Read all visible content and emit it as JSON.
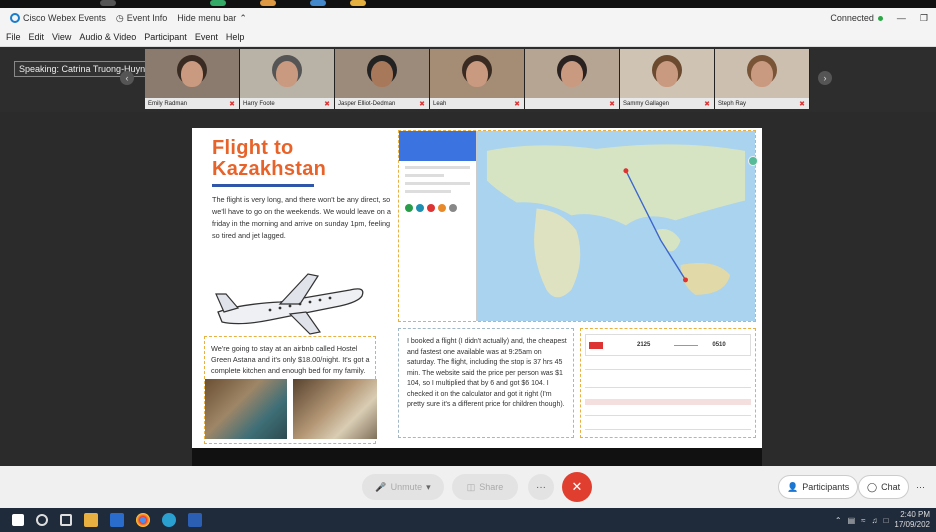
{
  "window": {
    "app_title": "Cisco Webex Events",
    "event_info": "Event Info",
    "hide_menu": "Hide menu bar",
    "status": "Connected"
  },
  "menu": [
    "File",
    "Edit",
    "View",
    "Audio & Video",
    "Participant",
    "Event",
    "Help"
  ],
  "speaking": "Speaking: Catrina Truong-Huynh",
  "participants": [
    {
      "name": "Emily Radman"
    },
    {
      "name": "Harry Foote"
    },
    {
      "name": "Jasper Elliot-Dedman"
    },
    {
      "name": "Leah"
    },
    {
      "name": ""
    },
    {
      "name": "Sammy Gallagen"
    },
    {
      "name": "Steph Ray"
    }
  ],
  "slide": {
    "title_line1": "Flight to",
    "title_line2": "Kazakhstan",
    "intro": "The flight is very long, and there won't be any direct, so we'll have to go on the weekends. We would leave on a friday in the morning and arrive on sunday 1pm, feeling so tired and jet lagged.",
    "hostel": "We're going to stay at an airbnb called Hostel Green Astana and it's only $18.00/night. It's got a complete kitchen and enough bed for my family.",
    "flight": "I booked a flight (I didn't actually) and, the cheapest and fastest one available was at 9:25am on saturday. The flight, including the stop is 37 hrs 45 min. The website said the price per person was $1 104, so I multiplied that by 6 and got $6 104. I checked it on the calculator and got it right (I'm pretty sure it's a different price for children though)."
  },
  "itinerary": {
    "depart": "2125",
    "arrive": "0510"
  },
  "controls": {
    "unmute": "Unmute",
    "share": "Share",
    "more": "···",
    "end": "✕",
    "participants": "Participants",
    "chat": "Chat",
    "menu": "···"
  },
  "taskbar": {
    "time": "2:40 PM",
    "date": "17/09/202"
  },
  "colors": {
    "accent_orange": "#e8632a",
    "webex_blue": "#1a7ccc",
    "end_red": "#e03f2f"
  }
}
